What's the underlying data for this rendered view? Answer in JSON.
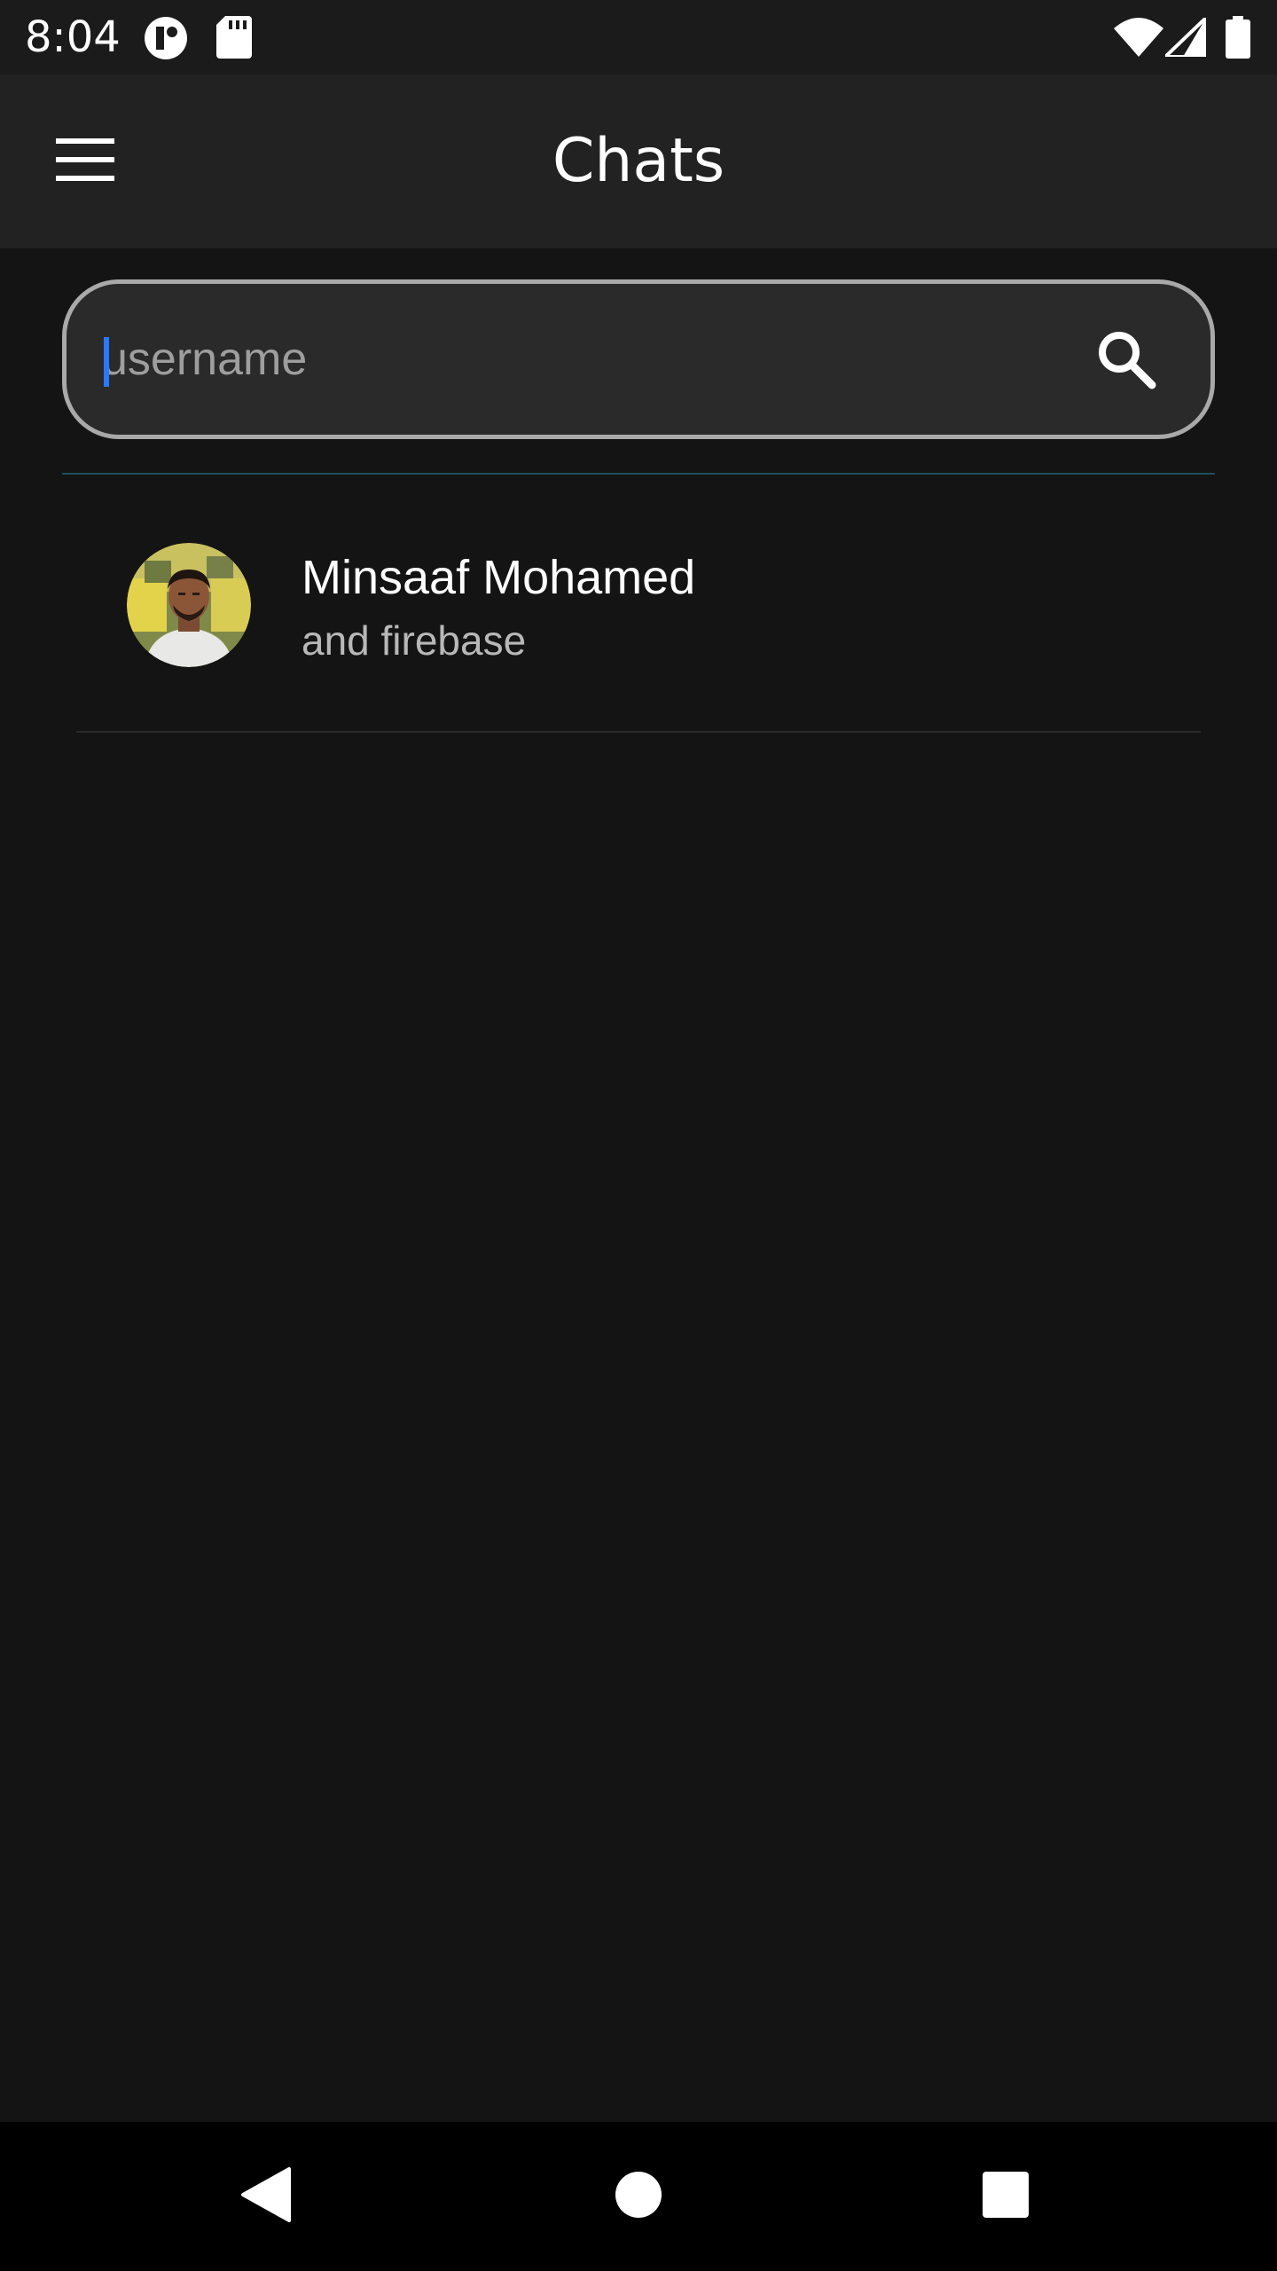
{
  "status_bar": {
    "time": "8:04",
    "left_icons": [
      "app-notification-icon",
      "sd-card-icon"
    ],
    "right_icons": [
      "wifi-icon",
      "signal-icon",
      "battery-icon"
    ]
  },
  "app_bar": {
    "title": "Chats",
    "menu_icon": "hamburger-menu-icon"
  },
  "search": {
    "value": "",
    "placeholder": "username",
    "icon": "search-icon"
  },
  "chats": [
    {
      "name": "Minsaaf Mohamed",
      "subtitle": "and firebase",
      "avatar": "avatar-photo"
    }
  ],
  "nav_bar": {
    "back_icon": "back-triangle-icon",
    "home_icon": "home-circle-icon",
    "recents_icon": "recents-square-icon"
  },
  "colors": {
    "background": "#141414",
    "app_bar": "#222222",
    "accent_caret": "#2979ff",
    "search_border": "#a9a9a9"
  }
}
